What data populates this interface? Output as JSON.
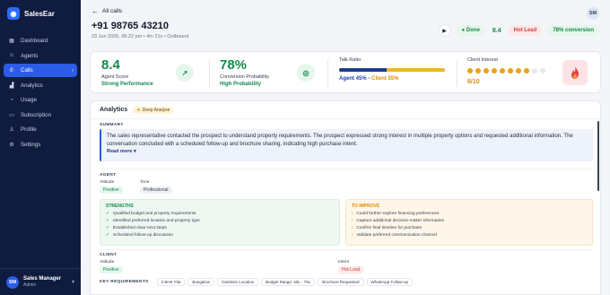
{
  "sidebar": {
    "brand": "SalesEar",
    "items": [
      {
        "label": "Dashboard",
        "icon": "grid-icon"
      },
      {
        "label": "Agents",
        "icon": "users-icon"
      },
      {
        "label": "Calls",
        "icon": "phone-icon"
      },
      {
        "label": "Analytics",
        "icon": "chart-icon"
      },
      {
        "label": "Usage",
        "icon": "gauge-icon"
      },
      {
        "label": "Subscription",
        "icon": "card-icon"
      },
      {
        "label": "Profile",
        "icon": "user-icon"
      },
      {
        "label": "Settings",
        "icon": "gear-icon"
      }
    ],
    "user": {
      "initials": "SM",
      "name": "Sales Manager",
      "role": "Admin"
    }
  },
  "header": {
    "back_label": "All calls",
    "phone": "+91 98765 43210",
    "meta": "23 Jun 2026, 06:22 pm • 4m 21s • Outbound",
    "avatar_initials": "SM",
    "status": "Done",
    "score": "8.4",
    "lead": "Hot Lead",
    "conversion": "78% conversion"
  },
  "stats": {
    "agent_score": {
      "value": "8.4",
      "label": "Agent Score",
      "sub": "Strong Performance"
    },
    "conversion": {
      "value": "78%",
      "label": "Conversion Probability",
      "sub": "High Probability"
    },
    "talk_ratio": {
      "title": "Talk Ratio",
      "agent_pct": 45,
      "agent_text": "Agent 45%",
      "client_text": "Client 55%"
    },
    "client_interest": {
      "title": "Client Interest",
      "value": "8/10",
      "filled": 8,
      "total": 10
    }
  },
  "analytics": {
    "title": "Analytics",
    "deep_label": "Deep Analyse",
    "summary_label": "SUMMARY",
    "summary": "The sales representative contacted the prospect to understand property requirements. The prospect expressed strong interest in multiple property options and requested additional information. The conversation concluded with a scheduled follow-up and brochure sharing, indicating high purchase intent.",
    "read_more": "Read more",
    "agent": {
      "label": "AGENT",
      "attitude_label": "Attitude",
      "attitude": "Positive",
      "tone_label": "Tone",
      "tone": "Professional"
    },
    "strengths_title": "STRENGTHS",
    "strengths": [
      "Qualified budget and property requirements",
      "Identified preferred location and property type",
      "Established clear next steps",
      "Scheduled follow-up discussion"
    ],
    "improve_title": "TO IMPROVE",
    "improve": [
      "Could further explore financing preferences",
      "Capture additional decision-maker information",
      "Confirm final timeline for purchase",
      "Validate preferred communication channel"
    ],
    "client": {
      "label": "CLIENT",
      "attitude_label": "Attitude",
      "attitude": "Positive",
      "intent_label": "Intent",
      "intent": "Hot Lead"
    },
    "requirements_label": "KEY REQUIREMENTS",
    "requirements": [
      "3 BHK Flat",
      "Bungalow",
      "Outskirts Location",
      "Budget Range: 50L - 75L",
      "Brochure Requested",
      "WhatsApp Follow-up"
    ]
  },
  "colors": {
    "accent": "#2c5be6",
    "sidebar": "#0f1c3f",
    "green": "#138a4b",
    "orange": "#d98d00",
    "red": "#d43f3f"
  }
}
